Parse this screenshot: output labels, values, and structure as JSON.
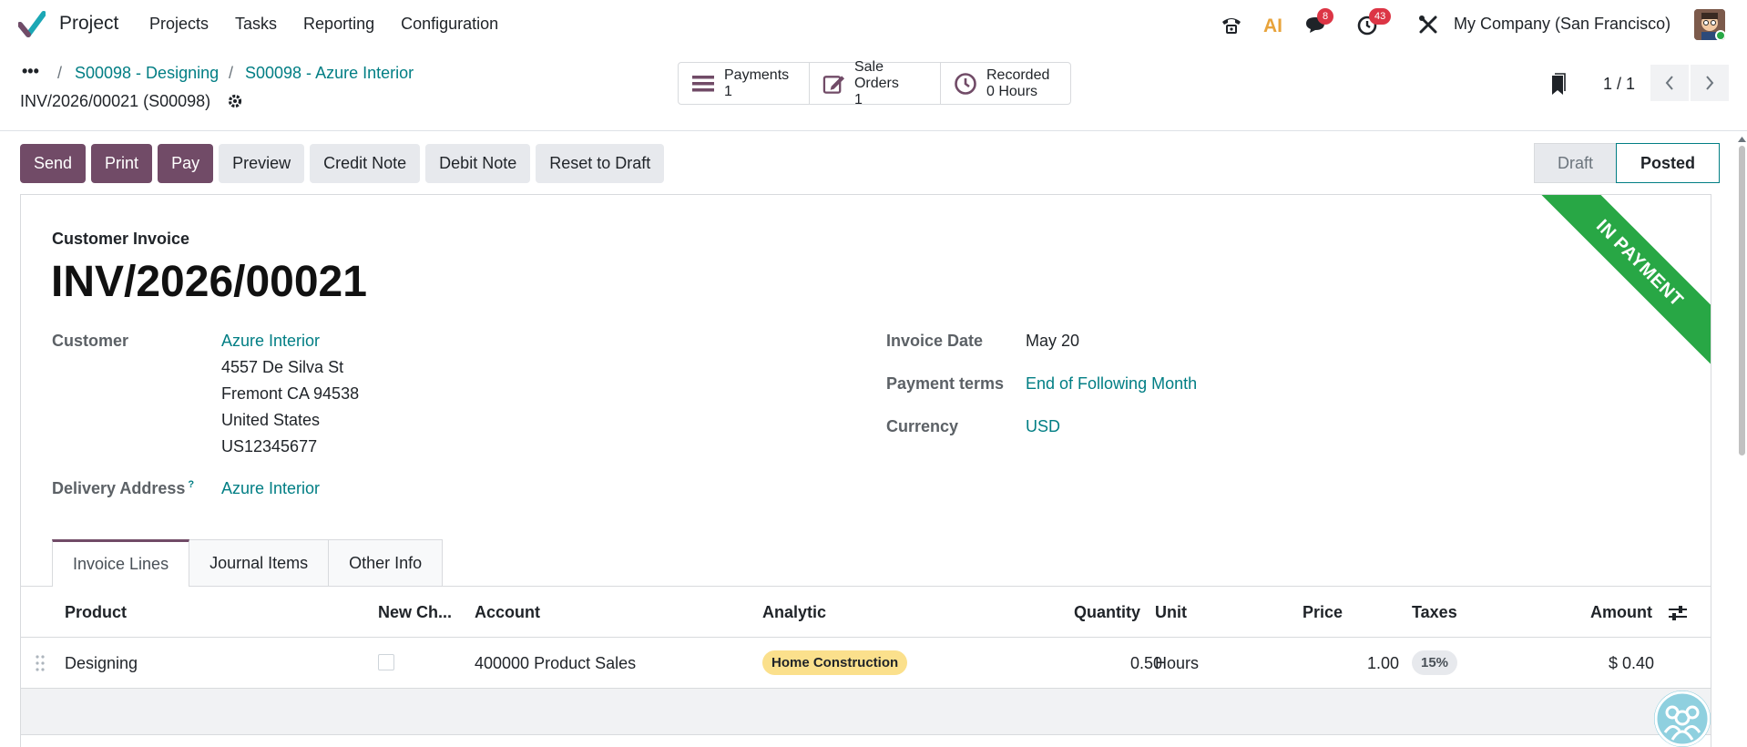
{
  "navbar": {
    "app_name": "Project",
    "menu": [
      "Projects",
      "Tasks",
      "Reporting",
      "Configuration"
    ],
    "icons": {
      "phone": "phone-icon",
      "ai": "ai-icon",
      "ai_label": "AI",
      "messages": "chat-icon",
      "activities": "clock-icon",
      "debug": "tools-icon"
    },
    "messages_count": "8",
    "activities_count": "43",
    "company": "My Company (San Francisco)"
  },
  "control_panel": {
    "breadcrumb_dots": "•••",
    "breadcrumbs": [
      "S00098 - Designing",
      "S00098 - Azure Interior"
    ],
    "record_name": "INV/2026/00021 (S00098)",
    "smart_buttons": [
      {
        "label": "Payments",
        "value": "1",
        "icon": "list-icon"
      },
      {
        "label": "Sale Orders",
        "value": "1",
        "icon": "edit-icon"
      },
      {
        "label": "Recorded",
        "value": "0 Hours",
        "icon": "clock-icon"
      }
    ],
    "pager": "1 / 1"
  },
  "actions": {
    "primary": [
      "Send",
      "Print",
      "Pay"
    ],
    "secondary": [
      "Preview",
      "Credit Note",
      "Debit Note",
      "Reset to Draft"
    ]
  },
  "status": {
    "draft": "Draft",
    "posted": "Posted",
    "current": "Posted"
  },
  "invoice": {
    "ribbon": "IN PAYMENT",
    "ribbon_color": "#28a745",
    "type": "Customer Invoice",
    "number": "INV/2026/00021",
    "customer_label": "Customer",
    "customer_name": "Azure Interior",
    "address": [
      "4557 De Silva St",
      "Fremont CA 94538",
      "United States",
      "US12345677"
    ],
    "delivery_label": "Delivery Address",
    "delivery_help": "?",
    "delivery_value": "Azure Interior",
    "invoice_date_label": "Invoice Date",
    "invoice_date": "May 20",
    "payment_terms_label": "Payment terms",
    "payment_terms": "End of Following Month",
    "currency_label": "Currency",
    "currency": "USD"
  },
  "tabs": [
    "Invoice Lines",
    "Journal Items",
    "Other Info"
  ],
  "lines_table": {
    "columns": [
      "Product",
      "New Ch...",
      "Account",
      "Analytic",
      "Quantity",
      "Unit",
      "Price",
      "Taxes",
      "Amount"
    ],
    "rows": [
      {
        "product": "Designing",
        "account": "400000 Product Sales",
        "analytic": "Home Construction",
        "quantity": "0.50",
        "unit": "Hours",
        "price": "1.00",
        "taxes": "15%",
        "amount": "$ 0.40"
      }
    ]
  },
  "colors": {
    "primary": "#714b67",
    "link": "#017e84",
    "analytic_tag": "#fbe08c",
    "tax_tag": "#e7e9ed"
  }
}
